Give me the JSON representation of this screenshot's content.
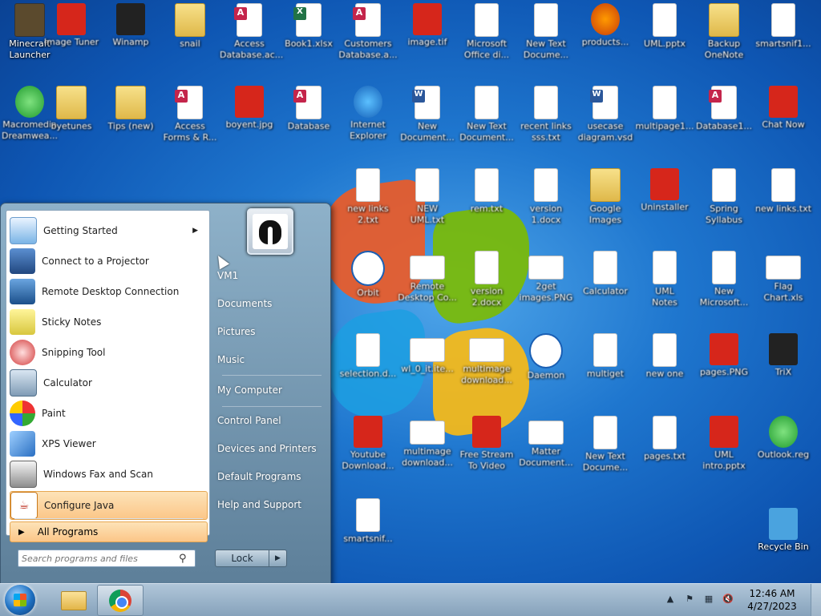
{
  "desktop": {
    "icons": [
      {
        "label": "Minecraft\nLauncher",
        "icon": "minecraft-icon"
      },
      {
        "label": "Image Tuner",
        "icon": "image-icon"
      },
      {
        "label": "Winamp",
        "icon": "winamp-icon"
      },
      {
        "label": "snail",
        "icon": "folder-icon"
      },
      {
        "label": "Access\nDatabase.ac...",
        "icon": "access-icon"
      },
      {
        "label": "Book1.xlsx",
        "icon": "excel-icon"
      },
      {
        "label": "Customers\nDatabase.a...",
        "icon": "access-icon"
      },
      {
        "label": "image.tif",
        "icon": "image-icon"
      },
      {
        "label": "Microsoft\nOffice di...",
        "icon": "file-icon"
      },
      {
        "label": "New Text\nDocume...",
        "icon": "file-icon"
      },
      {
        "label": "products...",
        "icon": "firefox-icon"
      },
      {
        "label": "UML.pptx",
        "icon": "file-icon"
      },
      {
        "label": "Backup\nOneNote",
        "icon": "folder-icon"
      },
      {
        "label": "smartsnif1...",
        "icon": "file-icon"
      },
      {
        "label": "Macromedia\nDreamwea...",
        "icon": "dreamweaver-icon"
      },
      {
        "label": "byetunes",
        "icon": "folder-icon"
      },
      {
        "label": "Tips (new)",
        "icon": "folder-icon"
      },
      {
        "label": "Access\nForms & R...",
        "icon": "access-icon"
      },
      {
        "label": "boyent.jpg",
        "icon": "image-icon"
      },
      {
        "label": "Database",
        "icon": "access-icon"
      },
      {
        "label": "Internet\nExplorer",
        "icon": "ie-icon"
      },
      {
        "label": "New\nDocument...",
        "icon": "word-icon"
      },
      {
        "label": "New Text\nDocument...",
        "icon": "file-icon"
      },
      {
        "label": "recent links\nsss.txt",
        "icon": "file-icon"
      },
      {
        "label": "usecase\ndiagram.vsd",
        "icon": "word-icon"
      },
      {
        "label": "multipage1...",
        "icon": "file-icon"
      },
      {
        "label": "Database1...",
        "icon": "access-icon"
      },
      {
        "label": "Chat Now",
        "icon": "chat-icon"
      },
      {
        "label": "new links\n2.txt",
        "icon": "file-icon"
      },
      {
        "label": "NEW\nUML.txt",
        "icon": "file-icon"
      },
      {
        "label": "rem.txt",
        "icon": "file-icon"
      },
      {
        "label": "version\n1.docx",
        "icon": "file-icon"
      },
      {
        "label": "Google\nImages",
        "icon": "folder-icon"
      },
      {
        "label": "Uninstaller",
        "icon": "video-icon"
      },
      {
        "label": "Spring\nSyllabus",
        "icon": "file-icon"
      },
      {
        "label": "new links.txt",
        "icon": "file-icon"
      },
      {
        "label": "Orbit",
        "icon": "orbit-icon"
      },
      {
        "label": "Remote\nDesktop Co...",
        "icon": "screenshot-icon"
      },
      {
        "label": "version\n2.docx",
        "icon": "file-icon"
      },
      {
        "label": "2get\nimages.PNG",
        "icon": "screenshot-icon"
      },
      {
        "label": "Calculator",
        "icon": "file-icon"
      },
      {
        "label": "UML\nNotes",
        "icon": "file-icon"
      },
      {
        "label": "New\nMicrosoft...",
        "icon": "file-icon"
      },
      {
        "label": "Flag\nChart.xls",
        "icon": "screenshot-icon"
      },
      {
        "label": "selection.d...",
        "icon": "file-icon"
      },
      {
        "label": "wl_0_it.ite...",
        "icon": "screenshot-icon"
      },
      {
        "label": "multimage\ndownload...",
        "icon": "screenshot-icon"
      },
      {
        "label": "Daemon",
        "icon": "globe-icon"
      },
      {
        "label": "multiget",
        "icon": "file-icon"
      },
      {
        "label": "new one",
        "icon": "file-icon"
      },
      {
        "label": "pages.PNG",
        "icon": "image-icon"
      },
      {
        "label": "TriX",
        "icon": "trix-icon"
      },
      {
        "label": "Youtube\nDownload...",
        "icon": "video-icon"
      },
      {
        "label": "multimage\ndownload...",
        "icon": "screenshot-icon"
      },
      {
        "label": "Free Stream\nTo Video",
        "icon": "image-icon"
      },
      {
        "label": "Matter\nDocument...",
        "icon": "screenshot-icon"
      },
      {
        "label": "New Text\nDocume...",
        "icon": "file-icon"
      },
      {
        "label": "pages.txt",
        "icon": "file-icon"
      },
      {
        "label": "UML\nintro.pptx",
        "icon": "image-icon"
      },
      {
        "label": "Outlook.reg",
        "icon": "reg-icon"
      },
      {
        "label": "smartsnif...",
        "icon": "file-icon"
      },
      {
        "label": "Recycle Bin",
        "icon": "recycle-bin-icon"
      }
    ]
  },
  "start_menu": {
    "programs": [
      {
        "label": "Getting Started",
        "icon": "getting-started-icon",
        "has_submenu": true
      },
      {
        "label": "Connect to a Projector",
        "icon": "projector-icon"
      },
      {
        "label": "Remote Desktop Connection",
        "icon": "remote-desktop-icon"
      },
      {
        "label": "Sticky Notes",
        "icon": "sticky-notes-icon"
      },
      {
        "label": "Snipping Tool",
        "icon": "snipping-tool-icon"
      },
      {
        "label": "Calculator",
        "icon": "calculator-icon"
      },
      {
        "label": "Paint",
        "icon": "paint-icon"
      },
      {
        "label": "XPS Viewer",
        "icon": "xps-viewer-icon"
      },
      {
        "label": "Windows Fax and Scan",
        "icon": "fax-icon"
      },
      {
        "label": "Configure Java",
        "icon": "java-icon",
        "highlighted": true
      }
    ],
    "all_programs": "All Programs",
    "search_placeholder": "Search programs and files",
    "right_links": [
      {
        "label": "VM1"
      },
      {
        "label": "Documents"
      },
      {
        "label": "Pictures"
      },
      {
        "label": "Music"
      },
      {
        "label": "My Computer"
      },
      {
        "label": "Control Panel"
      },
      {
        "label": "Devices and Printers"
      },
      {
        "label": "Default Programs"
      },
      {
        "label": "Help and Support"
      }
    ],
    "lock_label": "Lock",
    "lock_arrow": "▶"
  },
  "taskbar": {
    "pinned": [
      {
        "name": "windows-explorer"
      },
      {
        "name": "google-chrome",
        "active": true
      }
    ],
    "clock": {
      "time": "12:46 AM",
      "date": "4/27/2023"
    }
  },
  "colors": {
    "desktop_blue": "#1f77cf",
    "highlight": "#fbc688",
    "taskbar": "#a2bace"
  }
}
